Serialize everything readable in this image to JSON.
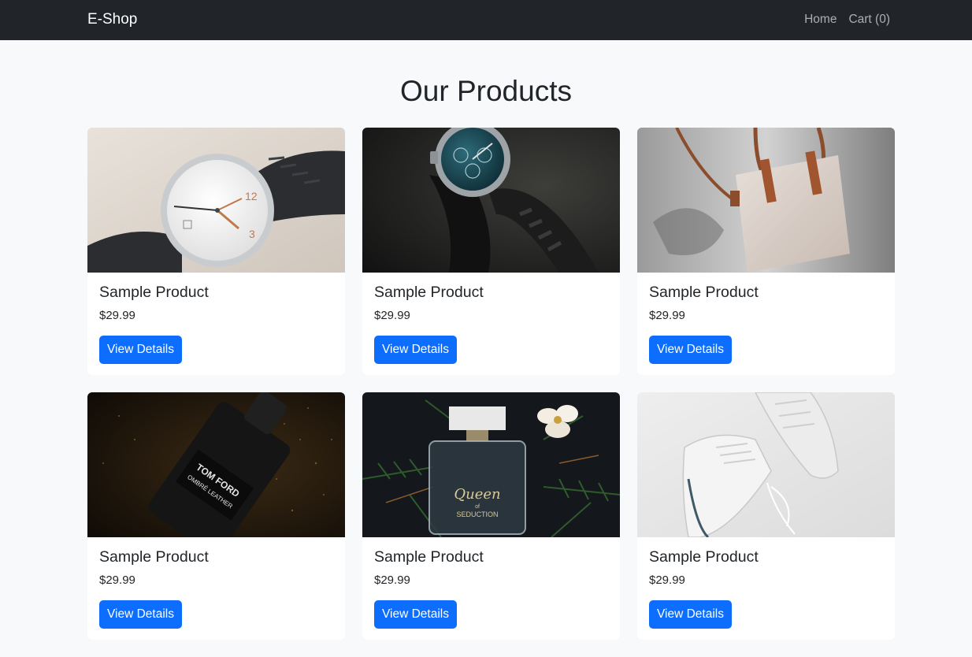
{
  "navbar": {
    "brand": "E-Shop",
    "links": [
      {
        "label": "Home"
      },
      {
        "label": "Cart (0)"
      }
    ]
  },
  "page_title": "Our Products",
  "products": [
    {
      "name": "Sample Product",
      "price": "$29.99",
      "button": "View Details",
      "image": "wristwatch-white-dial-photo"
    },
    {
      "name": "Sample Product",
      "price": "$29.99",
      "button": "View Details",
      "image": "chronograph-watch-dark-photo"
    },
    {
      "name": "Sample Product",
      "price": "$29.99",
      "button": "View Details",
      "image": "leather-tote-bag-photo"
    },
    {
      "name": "Sample Product",
      "price": "$29.99",
      "button": "View Details",
      "image": "cologne-bottle-black-photo",
      "image_text": [
        "TOM FORD",
        "OMBRÉ LEATHER"
      ]
    },
    {
      "name": "Sample Product",
      "price": "$29.99",
      "button": "View Details",
      "image": "perfume-bottle-pine-photo",
      "image_text": [
        "Queen",
        "of",
        "SEDUCTION"
      ]
    },
    {
      "name": "Sample Product",
      "price": "$29.99",
      "button": "View Details",
      "image": "white-sneakers-photo"
    }
  ],
  "colors": {
    "navbar_bg": "#212529",
    "page_bg": "#f8f9fa",
    "button_bg": "#0d6efd"
  }
}
